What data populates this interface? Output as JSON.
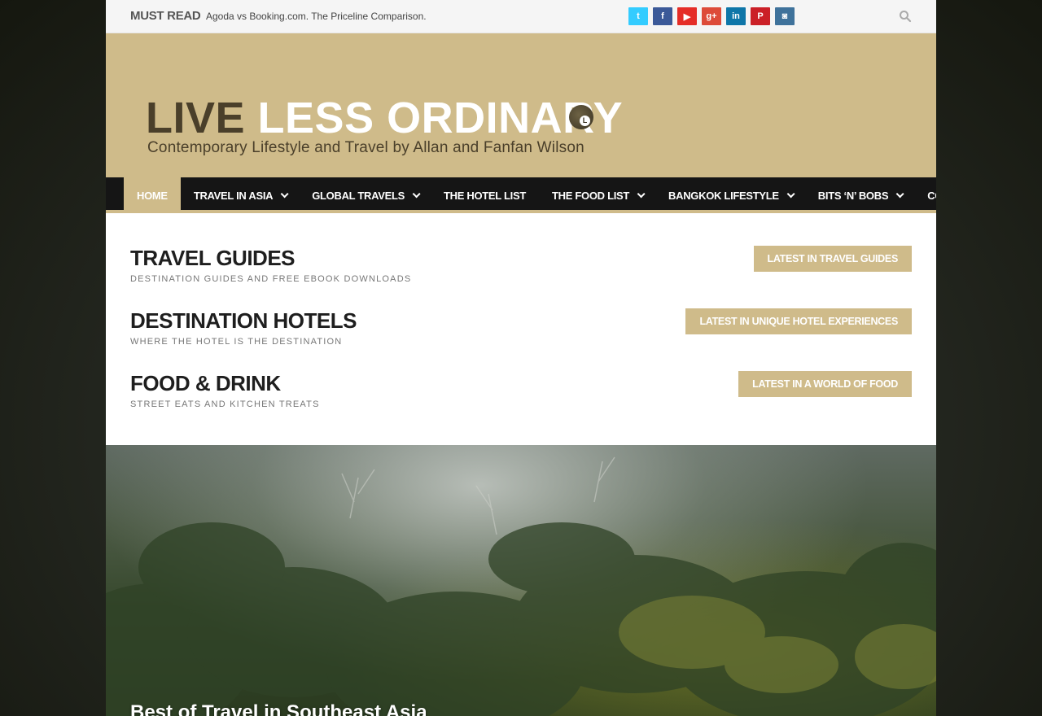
{
  "topbar": {
    "must_read_label": "MUST READ",
    "must_read_link": "Agoda vs Booking.com. The Priceline Comparison.",
    "socials": [
      {
        "icon": "twitter-icon",
        "glyph": "t",
        "color": "#33ccff"
      },
      {
        "icon": "facebook-icon",
        "glyph": "f",
        "color": "#3b5998"
      },
      {
        "icon": "youtube-icon",
        "glyph": "▶",
        "color": "#e52d27"
      },
      {
        "icon": "google-plus-icon",
        "glyph": "g+",
        "color": "#dd4b39"
      },
      {
        "icon": "linkedin-icon",
        "glyph": "in",
        "color": "#0e76a8"
      },
      {
        "icon": "pinterest-icon",
        "glyph": "P",
        "color": "#cb2027"
      },
      {
        "icon": "instagram-icon",
        "glyph": "◙",
        "color": "#3f729b"
      }
    ]
  },
  "header": {
    "logo_word1": "LIVE",
    "logo_word2": "LESS ORDINARY",
    "logo_badge": "L",
    "tagline": "Contemporary Lifestyle and Travel by Allan and Fanfan Wilson",
    "bg_color": "#cfbb8a"
  },
  "nav": {
    "items": [
      {
        "label": "HOME",
        "dropdown": false,
        "active": true
      },
      {
        "label": "TRAVEL IN ASIA",
        "dropdown": true
      },
      {
        "label": "GLOBAL TRAVELS",
        "dropdown": true
      },
      {
        "label": "THE HOTEL LIST",
        "dropdown": false
      },
      {
        "label": "THE FOOD LIST",
        "dropdown": true
      },
      {
        "label": "BANGKOK LIFESTYLE",
        "dropdown": true
      },
      {
        "label": "BITS ‘N’ BOBS",
        "dropdown": true
      },
      {
        "label": "CONTACT",
        "dropdown": true
      }
    ]
  },
  "sections": [
    {
      "title": "TRAVEL GUIDES",
      "subtitle": "DESTINATION GUIDES AND FREE EBOOK DOWNLOADS",
      "button": "LATEST IN TRAVEL GUIDES"
    },
    {
      "title": "DESTINATION HOTELS",
      "subtitle": "WHERE THE HOTEL IS THE DESTINATION",
      "button": "LATEST IN UNIQUE HOTEL EXPERIENCES"
    },
    {
      "title": "FOOD & DRINK",
      "subtitle": "STREET EATS AND KITCHEN TREATS",
      "button": "LATEST IN A WORLD OF FOOD"
    }
  ],
  "hero": {
    "title": "Best of Travel in Southeast Asia"
  }
}
